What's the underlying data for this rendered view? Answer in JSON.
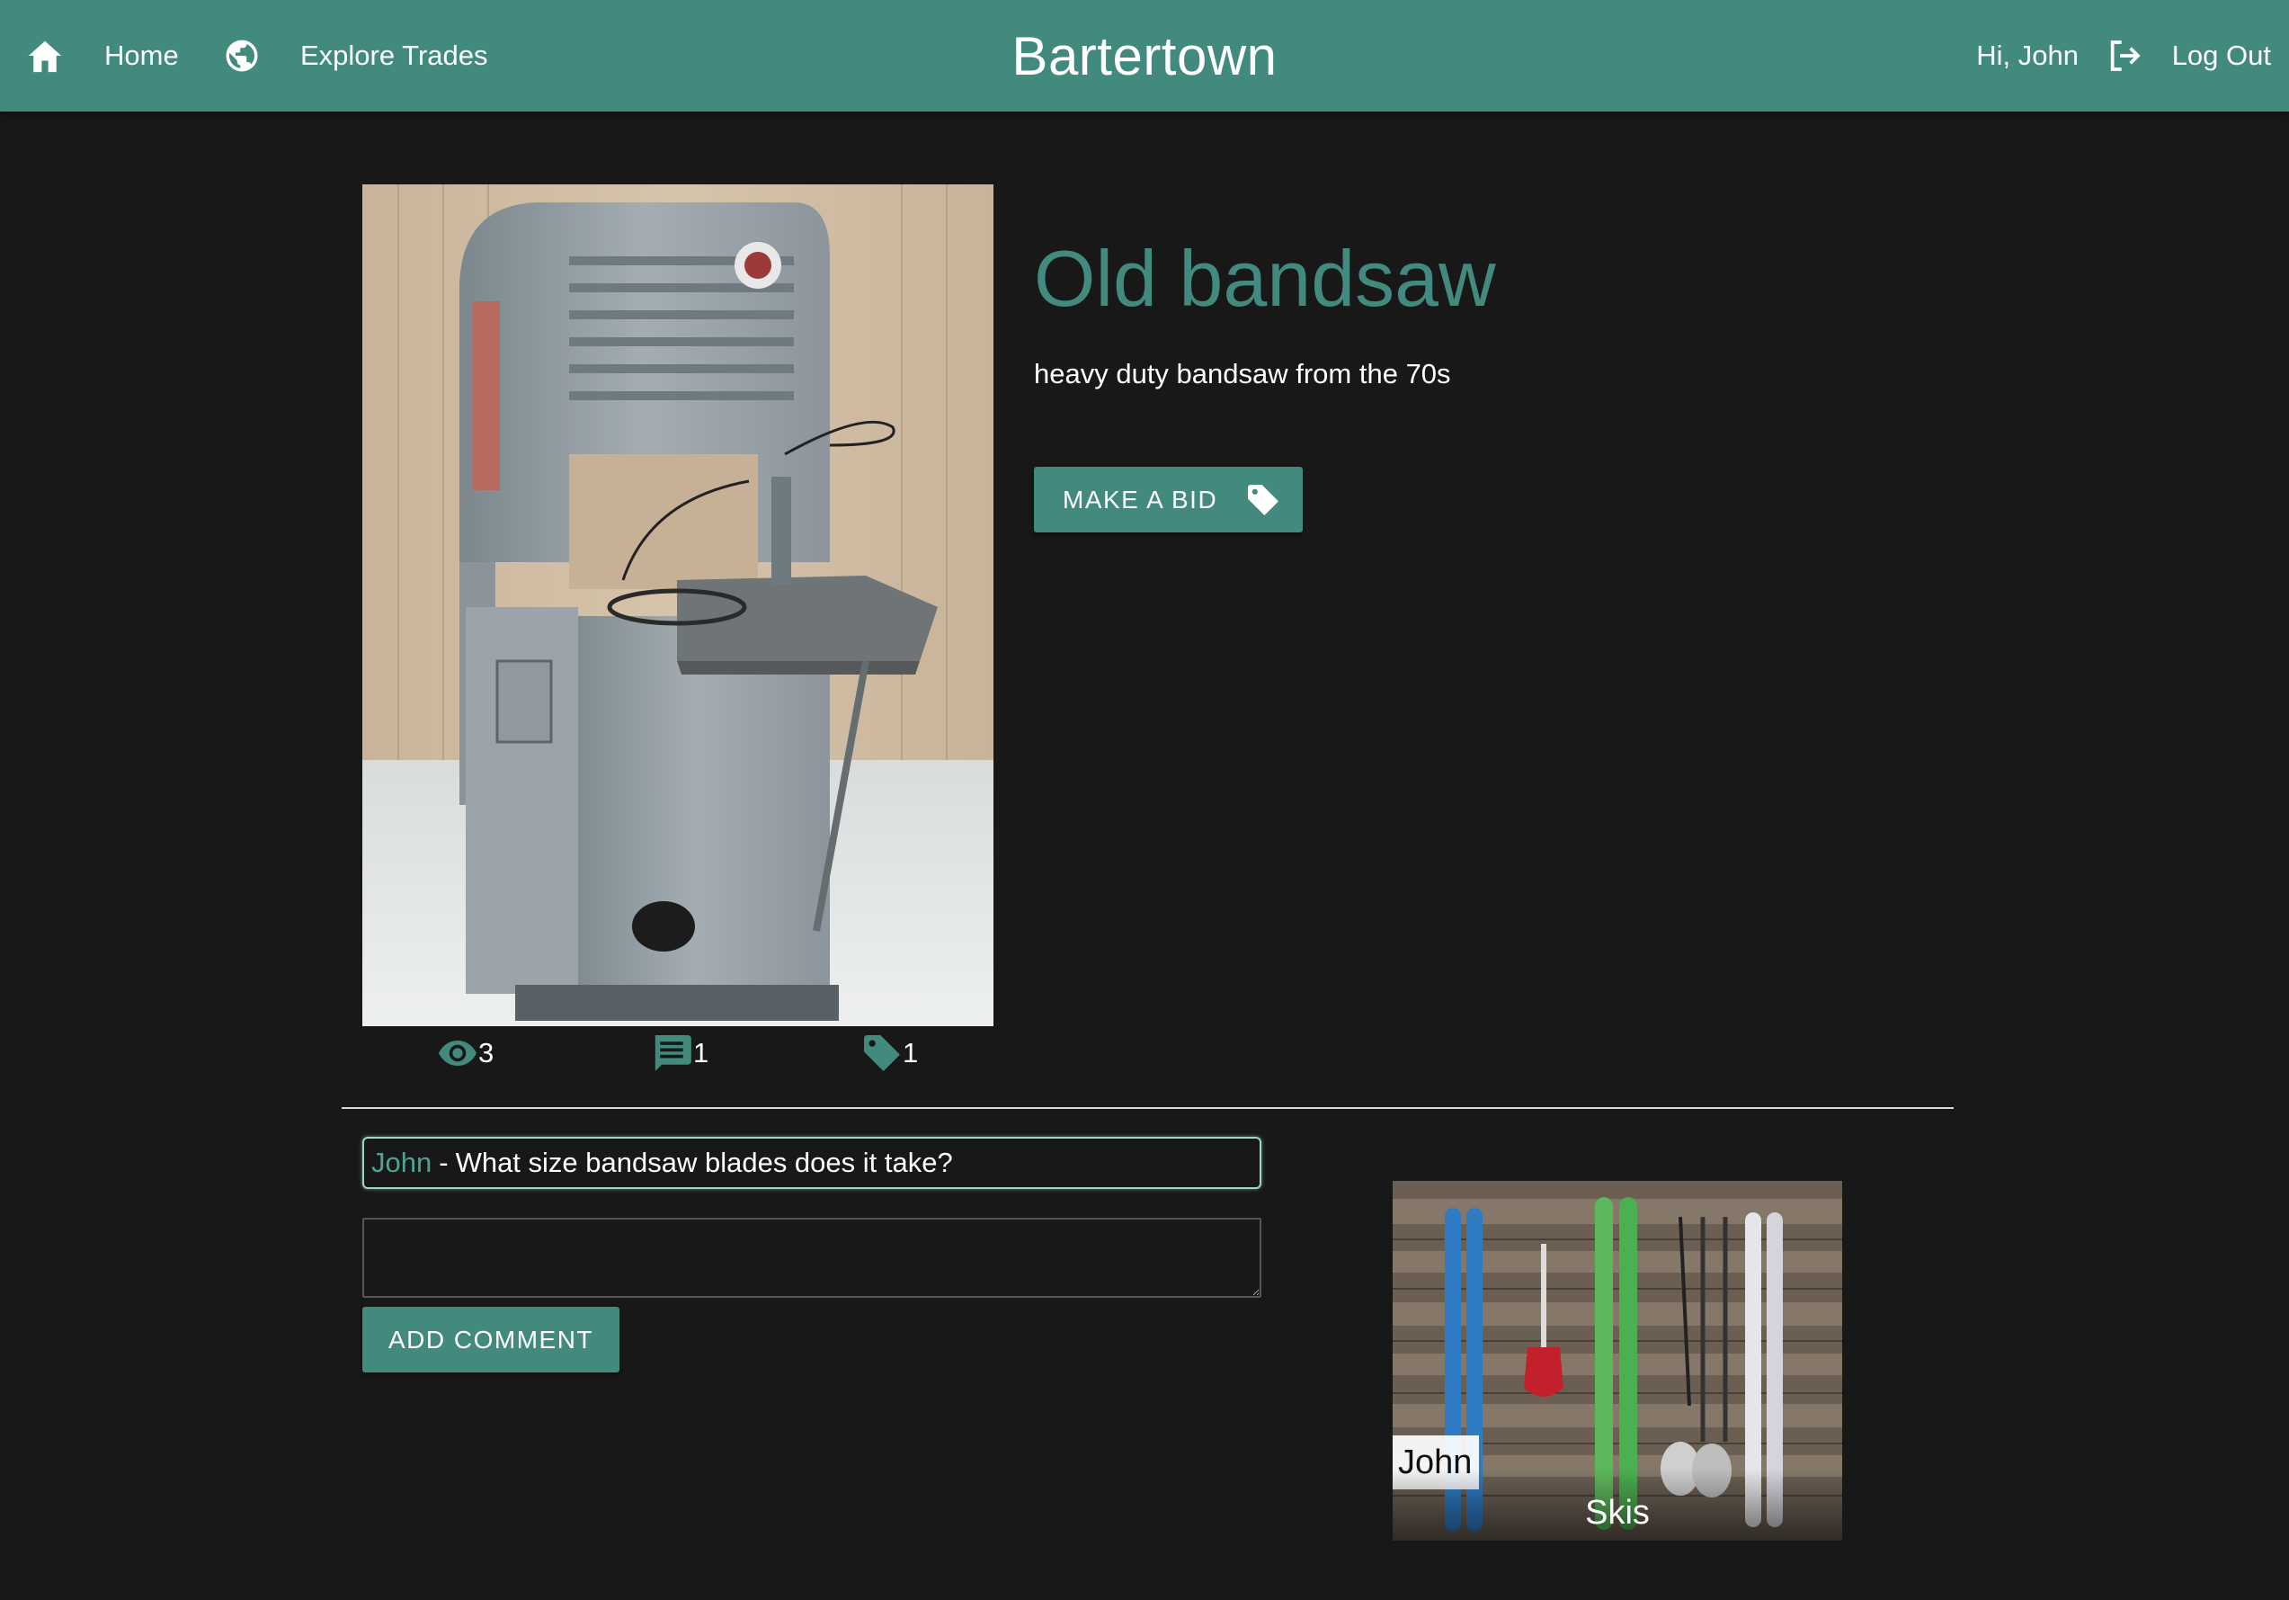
{
  "navbar": {
    "home_label": "Home",
    "explore_label": "Explore Trades",
    "brand": "Bartertown",
    "greeting": "Hi, John",
    "logout_label": "Log Out",
    "color": "#418a7d"
  },
  "item": {
    "title": "Old bandsaw",
    "description": "heavy duty bandsaw from the 70s",
    "bid_button_label": "MAKE A BID",
    "stats": {
      "views": "3",
      "comments": "1",
      "bids": "1"
    }
  },
  "comments": [
    {
      "author": "John",
      "separator": "-",
      "text": "What size bandsaw blades does it take?"
    }
  ],
  "comment_form": {
    "value": "",
    "button_label": "ADD COMMENT"
  },
  "related": [
    {
      "owner": "John",
      "title": "Skis"
    }
  ],
  "icons": {
    "home": "home-icon",
    "explore": "globe-icon",
    "logout": "logout-icon",
    "bid": "tag-icon",
    "views": "eye-icon",
    "comments": "chat-icon",
    "bids": "tag-icon"
  },
  "colors": {
    "accent": "#418a7d",
    "background": "#181818",
    "comment_author": "#4fa392"
  }
}
